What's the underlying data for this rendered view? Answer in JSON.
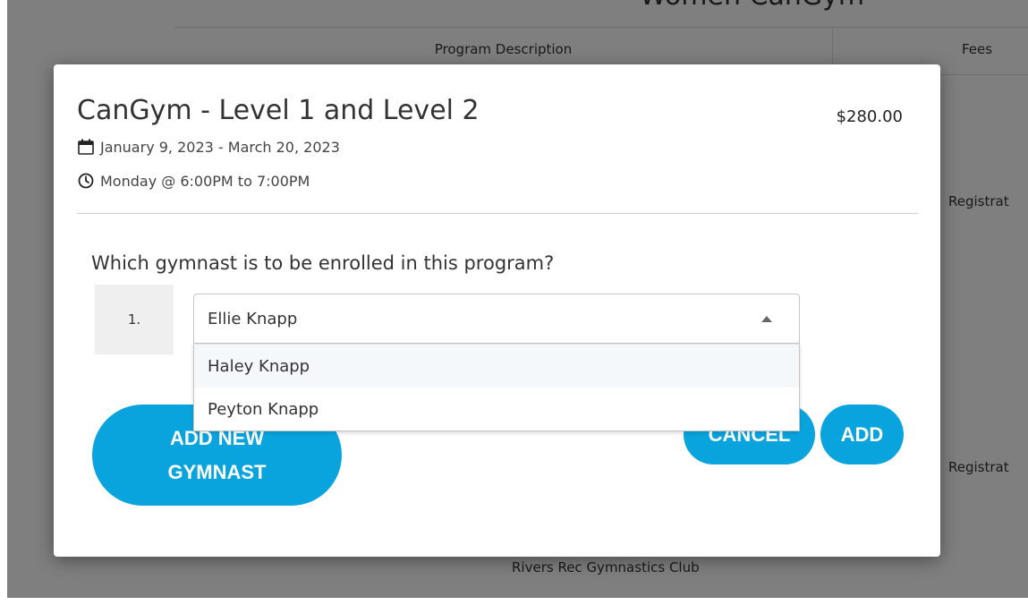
{
  "background": {
    "heading": "Women CanGym",
    "columns": {
      "description": "Program Description",
      "fees": "Fees"
    },
    "row_action": "Registrat",
    "footer": "Rivers Rec Gymnastics Club"
  },
  "modal": {
    "title": "CanGym - Level 1 and Level 2",
    "price": "$280.00",
    "date_range": "January 9, 2023 - March 20, 2023",
    "schedule": "Monday @ 6:00PM to 7:00PM",
    "question": "Which gymnast is to be enrolled in this program?",
    "row_index": "1.",
    "select": {
      "selected": "Ellie Knapp",
      "options": [
        "Haley Knapp",
        "Peyton Knapp"
      ]
    },
    "buttons": {
      "add_new_line1": "ADD NEW",
      "add_new_line2": "GYMNAST",
      "cancel": "CANCEL",
      "add": "ADD"
    }
  },
  "colors": {
    "accent": "#09a4de",
    "overlay": "rgba(0,0,0,0.5)"
  },
  "icons": {
    "date": "calendar-icon",
    "time": "clock-icon",
    "select": "caret-up-icon"
  }
}
